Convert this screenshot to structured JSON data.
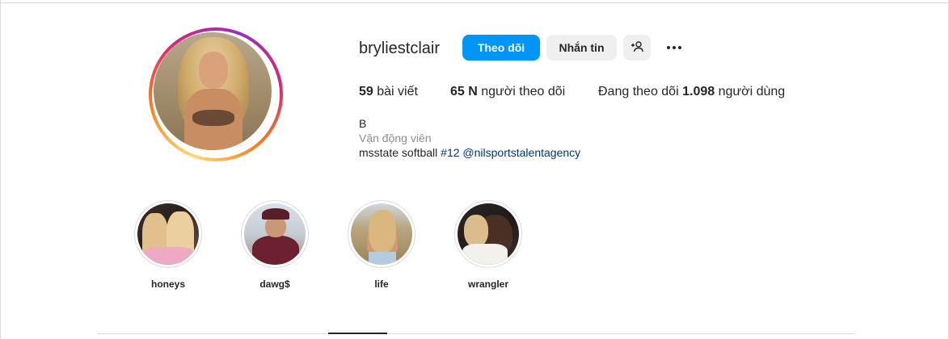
{
  "profile": {
    "username": "bryliestclair",
    "actions": {
      "follow_label": "Theo dõi",
      "message_label": "Nhắn tin",
      "suggest_icon": "person-add-icon",
      "more_icon": "more-horizontal-icon"
    },
    "stats": {
      "posts_count": "59",
      "posts_label": "bài viết",
      "followers_count": "65 N",
      "followers_label": "người theo dõi",
      "following_prefix": "Đang theo dõi",
      "following_count": "1.098",
      "following_suffix": "người dùng"
    },
    "bio": {
      "name": "B",
      "category": "Vận động viên",
      "text": "msstate softball",
      "hashtag": "#12",
      "mention": "@nilsportstalentagency"
    }
  },
  "highlights": [
    {
      "label": "honeys"
    },
    {
      "label": "dawg$"
    },
    {
      "label": "life"
    },
    {
      "label": "wrangler"
    }
  ],
  "colors": {
    "accent": "#0095f6",
    "link": "#00376b",
    "muted": "#8e8e8e",
    "button_secondary": "#efefef"
  }
}
